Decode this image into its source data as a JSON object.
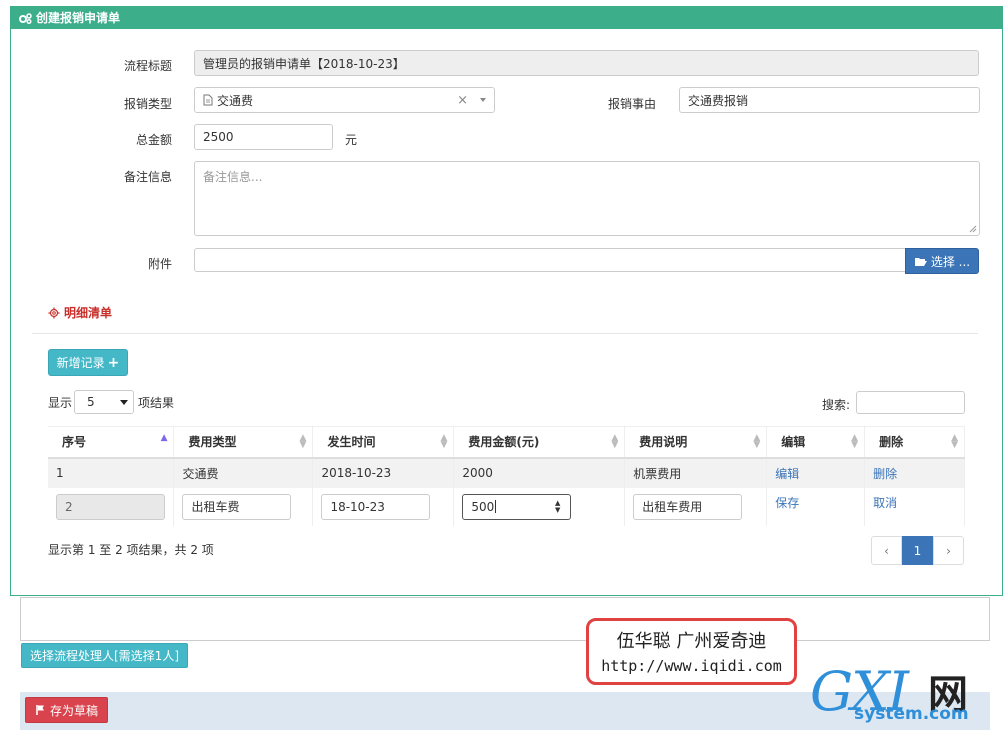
{
  "panel": {
    "title": "创建报销申请单"
  },
  "form": {
    "flow_title_label": "流程标题",
    "flow_title_value": "管理员的报销申请单【2018-10-23】",
    "type_label": "报销类型",
    "type_value": "交通费",
    "type_clear": "×",
    "reason_label": "报销事由",
    "reason_value": "交通费报销",
    "total_label": "总金额",
    "total_value": "2500",
    "total_unit": "元",
    "remark_label": "备注信息",
    "remark_placeholder": "备注信息...",
    "attach_label": "附件",
    "attach_button": "选择 ..."
  },
  "detail": {
    "section_title": "明细清单",
    "add_button": "新增记录",
    "add_icon": "+",
    "show_label": "显示",
    "page_size": "5",
    "page_size_suffix": "项结果",
    "search_label": "搜索:",
    "columns": [
      "序号",
      "费用类型",
      "发生时间",
      "费用金额(元)",
      "费用说明",
      "编辑",
      "删除"
    ],
    "rows": [
      {
        "no": "1",
        "type": "交通费",
        "date": "2018-10-23",
        "amount": "2000",
        "desc": "机票费用",
        "edit": "编辑",
        "del": "删除"
      }
    ],
    "edit_row": {
      "no": "2",
      "type": "出租车费",
      "date": "18-10-23",
      "amount": "500",
      "desc": "出租车费用",
      "save": "保存",
      "cancel": "取消"
    },
    "summary": "显示第 1 至 2 项结果，共 2 项",
    "pager": {
      "prev": "‹",
      "current": "1",
      "next": "›"
    }
  },
  "actions": {
    "select_handler": "选择流程处理人[需选择1人]",
    "save_draft": "存为草稿"
  },
  "watermark": {
    "line1": "伍华聪 广州爱奇迪",
    "line2": "http://www.iqidi.com"
  },
  "logo": {
    "main": "GXI",
    "cn": "网",
    "sub": "system.com"
  },
  "colors": {
    "header": "#3cae8a",
    "primary": "#3b75b8",
    "teal": "#45b8c8",
    "danger": "#d9434d"
  }
}
